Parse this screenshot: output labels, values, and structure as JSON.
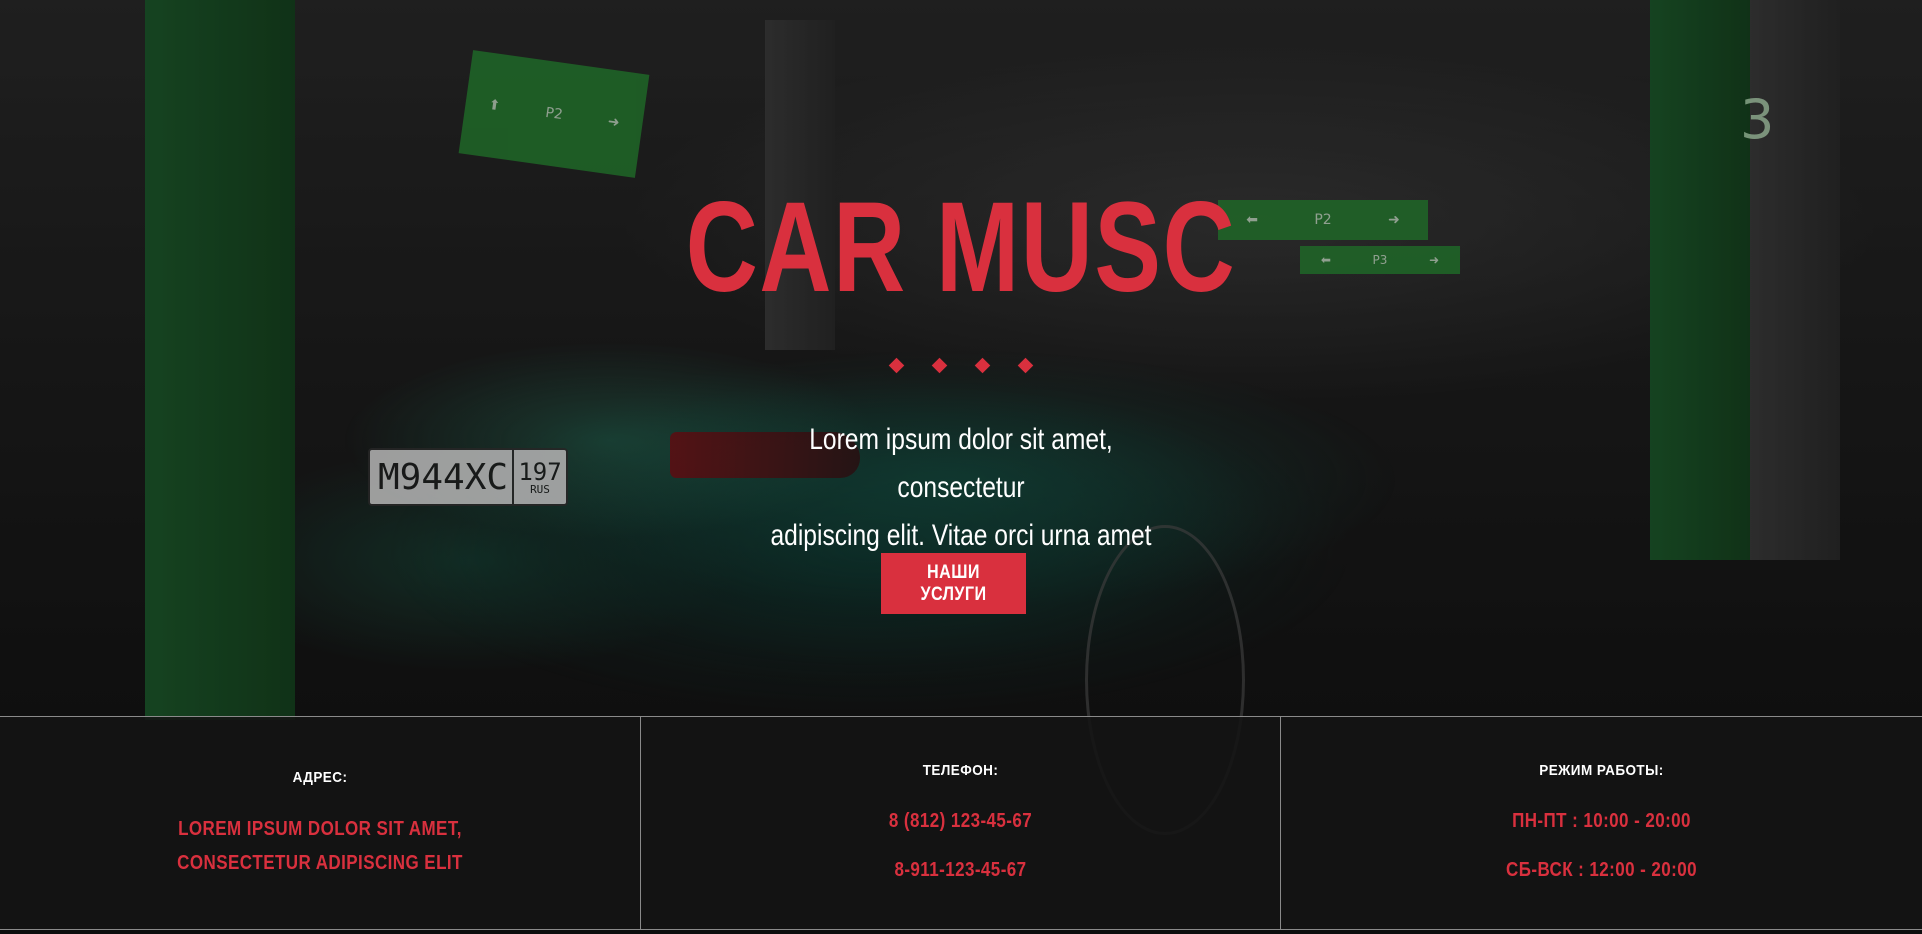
{
  "hero": {
    "title": "CAR MUSC",
    "lead_line1": "Lorem ipsum dolor sit amet, consectetur",
    "lead_line2": "adipiscing elit. Vitae orci urna amet penatibus.",
    "cta_label": "НАШИ УСЛУГИ",
    "divider_dots": 4,
    "background": {
      "plate_number": "М944ХС",
      "plate_region": "197",
      "plate_country": "RUS",
      "sign_left": "P2",
      "sign_right": "P3",
      "pillar_number": "3"
    }
  },
  "info": {
    "address": {
      "label": "АДРЕС:",
      "line1": "LOREM IPSUM DOLOR SIT AMET,",
      "line2": "CONSECTETUR ADIPISCING ELIT"
    },
    "phone": {
      "label": "ТЕЛЕФОН:",
      "line1": "8 (812) 123-45-67",
      "line2": "8-911-123-45-67"
    },
    "hours": {
      "label": "РЕЖИМ РАБОТЫ:",
      "line1": "ПН-ПТ : 10:00 - 20:00",
      "line2": "СБ-ВСК : 12:00 - 20:00"
    }
  },
  "colors": {
    "accent": "#d9303e",
    "text": "#ffffff",
    "background": "#141414",
    "divider": "#8a8a8a"
  }
}
